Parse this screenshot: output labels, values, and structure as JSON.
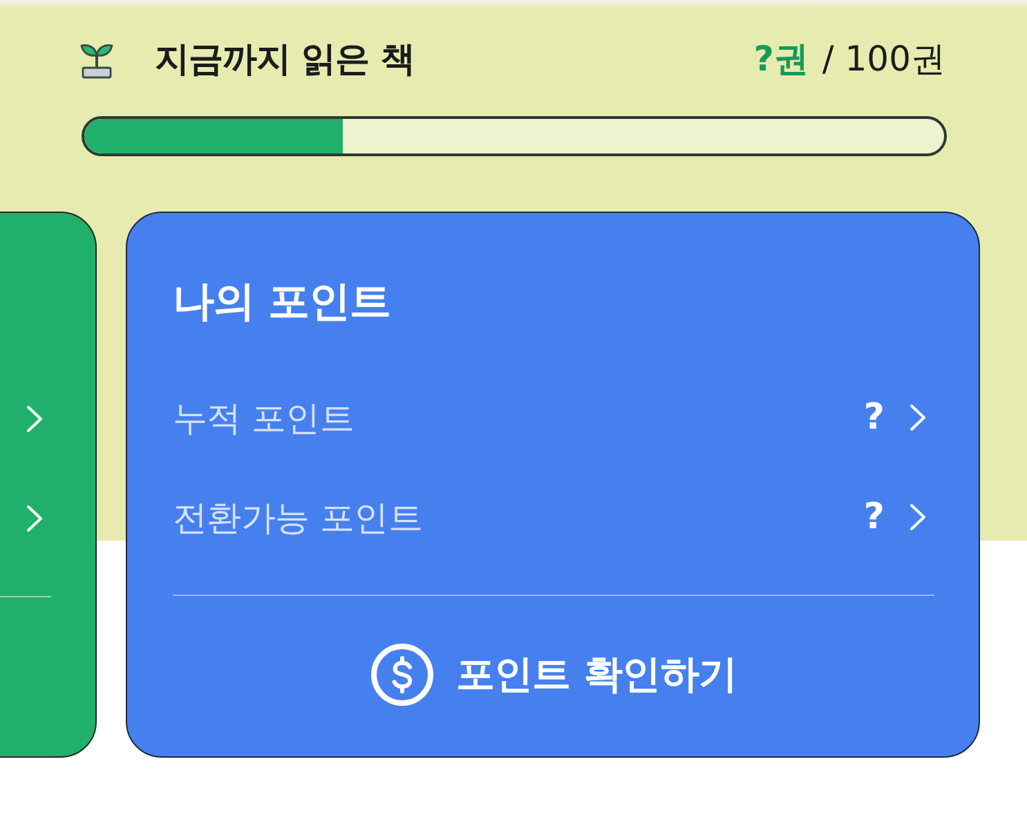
{
  "reading": {
    "title": "지금까지 읽은 책",
    "count_read": "?권",
    "count_total": "/ 100권",
    "level": 0.3
  },
  "side_card": {
    "rows": [
      {
        "kind": "link"
      },
      {
        "kind": "link"
      }
    ]
  },
  "points_card": {
    "title": "나의 포인트",
    "rows": [
      {
        "label": "누적 포인트",
        "value": "?"
      },
      {
        "label": "전환가능 포인트",
        "value": "?"
      }
    ],
    "button": "포인트 확인하기"
  }
}
